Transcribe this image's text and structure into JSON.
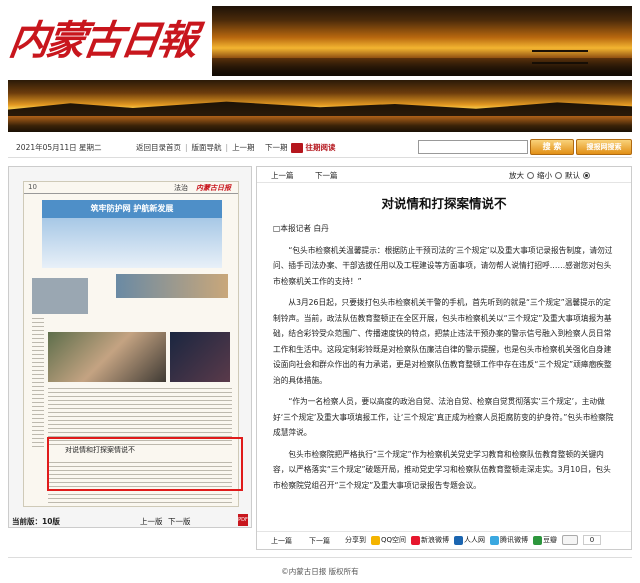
{
  "brand": {
    "logo_text": "内蒙古日報"
  },
  "nav": {
    "date": "2021年05月11日 星期二",
    "back_to_directory": "返回目录首页",
    "page_directory": "版面导航",
    "prev_page": "上一期",
    "next_page": "下一期",
    "read_label": "往期阅读",
    "search_button": "搜 索",
    "search_site_button": "搜报网搜索"
  },
  "paper": {
    "page_num": "10",
    "section": "法治",
    "masthead": "内蒙古日报",
    "banner": "筑牢防护网 护航新发展",
    "highlighted_title": "对说情和打探案情说不"
  },
  "left_footer": {
    "current_page": "当前版：10版",
    "prev": "上一版",
    "next": "下一版"
  },
  "article": {
    "toolbar": {
      "prev": "上一篇",
      "next": "下一篇",
      "zoom_in": "放大",
      "zoom_reset": "缩小",
      "zoom_default": "默认"
    },
    "title": "对说情和打探案情说不",
    "byline": "□本报记者  白丹",
    "paragraphs": [
      "“包头市检察机关温馨提示：根据防止干预司法的‘三个规定’以及重大事项记录报告制度，请勿过问、插手司法办案、干部选拔任用以及工程建设等方面事项，请勿帮人说情打招呼……感谢您对包头市检察机关工作的支持！”",
      "从3月26日起，只要拨打包头市检察机关干警的手机，首先听到的就是“三个规定”温馨提示的定制铃声。当前，政法队伍教育整顿正在全区开展，包头市检察机关以“三个规定”及重大事项填报为基础，结合彩铃受众范围广、传播速度快的特点，把禁止违法干预办案的警示信号融入到检察人员日常工作和生活中。这段定制彩铃既是对检察队伍廉洁自律的警示提醒，也是包头市检察机关强化自身建设面向社会和群众作出的有力承诺，更是对检察队伍教育整顿工作中存在违反“三个规定”顽瘴痼疾整治的具体措施。",
      "“作为一名检察人员，要以高度的政治自觉、法治自觉、检察自觉贯彻落实‘三个规定’，主动做好‘三个规定’及重大事项填报工作，让‘三个规定’真正成为检察人员拒腐防变的护身符。”包头市检察院成慧萍说。",
      "包头市检察院把严格执行“三个规定”作为检察机关党史学习教育和检察队伍教育整顿的关键内容，以严格落实“三个规定”破题开局，推动党史学习和检察队伍教育整顿走深走实。3月10日，包头市检察院党组召开“三个规定”及重大事项记录报告专题会议。"
    ],
    "share": {
      "prev": "上一篇",
      "next": "下一篇",
      "share_label": "分享到",
      "targets": [
        "QQ空间",
        "新浪微博",
        "人人网",
        "腾讯微博",
        "豆瓣"
      ],
      "like_count": "0"
    }
  },
  "footer": {
    "copyright": "©内蒙古日报 版权所有"
  },
  "colors": {
    "brand_red": "#c8161d",
    "accent_orange": "#e29016",
    "paper_blue": "#4e8fc8"
  }
}
